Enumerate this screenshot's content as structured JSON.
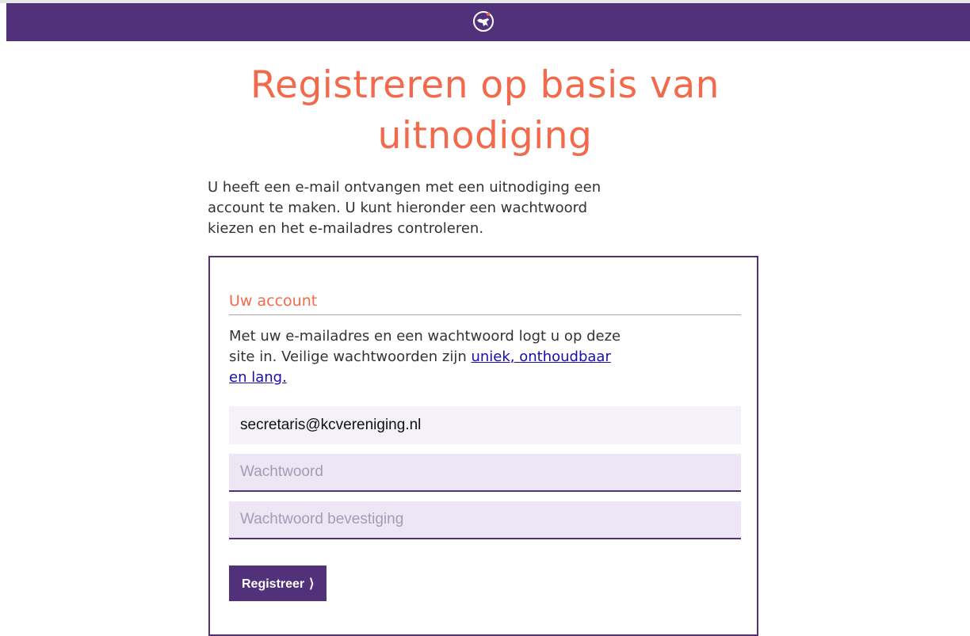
{
  "header": {
    "logo_icon": "dog-logo-icon",
    "bar_color": "#51317a"
  },
  "page": {
    "title": "Registreren op basis van uitnodiging",
    "intro": "U heeft een e-mail ontvangen met een uitnodiging een account te maken. U kunt hieronder een wachtwoord kiezen en het e-mailadres controleren."
  },
  "account_section": {
    "title": "Uw account",
    "description_prefix": "Met uw e-mailadres en een wachtwoord logt u op deze site in. Veilige wachtwoorden zijn ",
    "link_text": "uniek, onthoudbaar en lang.",
    "email_value": "secretaris@kcvereniging.nl",
    "password_placeholder": "Wachtwoord",
    "password_confirm_placeholder": "Wachtwoord bevestiging",
    "submit_label": "Registreer",
    "submit_icon": "chevron-right-icon"
  },
  "colors": {
    "accent": "#f26a4b",
    "brand": "#51317a"
  }
}
